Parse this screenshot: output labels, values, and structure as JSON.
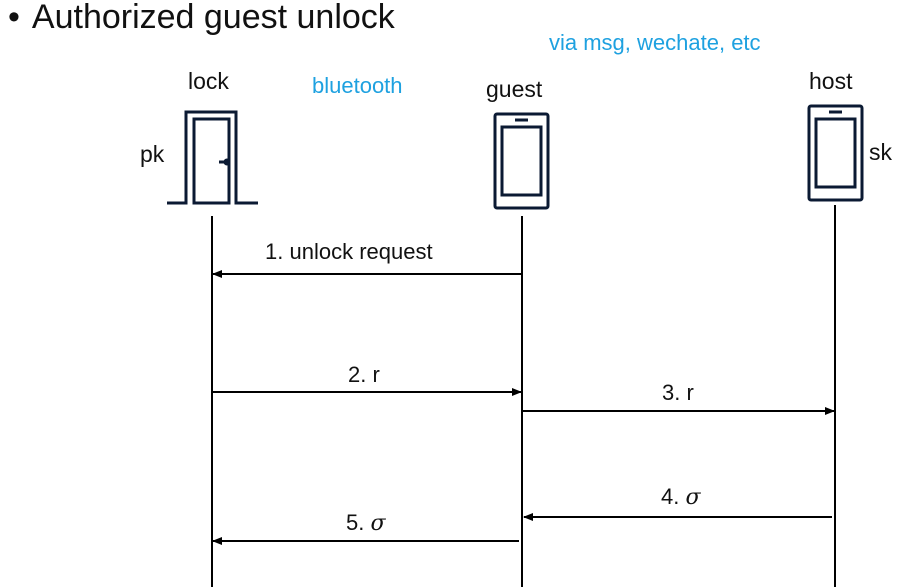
{
  "title": {
    "bullet": "•",
    "text": "Authorized guest unlock"
  },
  "channels": {
    "bluetooth": "bluetooth",
    "messaging": "via msg, wechate, etc"
  },
  "actors": {
    "lock": {
      "label": "lock",
      "key": "pk"
    },
    "guest": {
      "label": "guest"
    },
    "host": {
      "label": "host",
      "key": "sk"
    }
  },
  "messages": [
    {
      "step": "1.",
      "text": "unlock request",
      "from": "guest",
      "to": "lock"
    },
    {
      "step": "2.",
      "text": "r",
      "from": "lock",
      "to": "guest"
    },
    {
      "step": "3.",
      "text": "r",
      "from": "guest",
      "to": "host"
    },
    {
      "step": "4.",
      "text": "σ",
      "from": "host",
      "to": "guest"
    },
    {
      "step": "5.",
      "text": "σ",
      "from": "guest",
      "to": "lock"
    }
  ],
  "colors": {
    "accent": "#1ea1e0",
    "line": "#000000",
    "icon": "#0b1a33"
  },
  "icons": {
    "lock": "door-icon",
    "guest": "phone-icon",
    "host": "phone-icon"
  }
}
